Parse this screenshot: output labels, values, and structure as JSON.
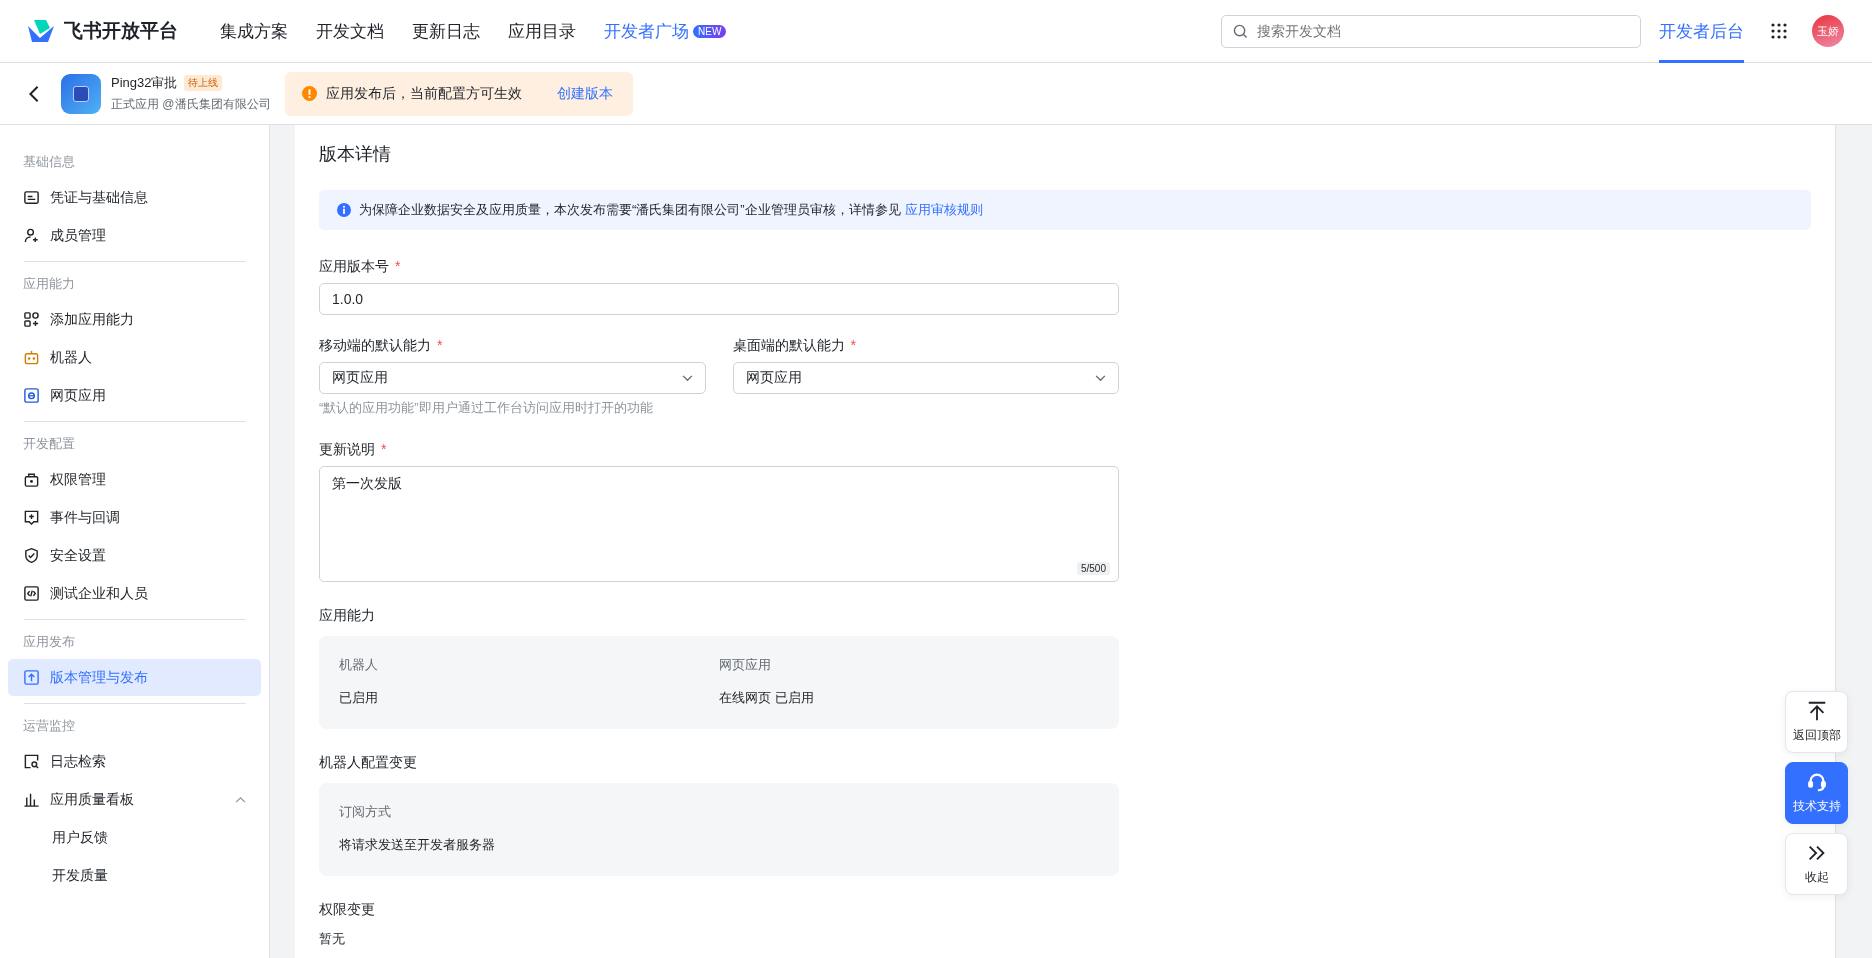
{
  "header": {
    "brand": "飞书开放平台",
    "nav": [
      {
        "label": "集成方案",
        "accent": false
      },
      {
        "label": "开发文档",
        "accent": false
      },
      {
        "label": "更新日志",
        "accent": false
      },
      {
        "label": "应用目录",
        "accent": false
      },
      {
        "label": "开发者广场",
        "accent": true,
        "badge": "NEW"
      }
    ],
    "search": {
      "placeholder": "搜索开发文档"
    },
    "console_link": {
      "label": "开发者后台",
      "selected": true
    },
    "avatar": "玉娇"
  },
  "app_bar": {
    "app_name": "Ping32审批",
    "status_badge": "待上线",
    "subtitle": "正式应用 @潘氏集团有限公司",
    "notice": {
      "text": "应用发布后，当前配置方可生效",
      "link": "创建版本"
    }
  },
  "sidebar": {
    "sections": [
      {
        "title": "基础信息",
        "items": [
          {
            "label": "凭证与基础信息",
            "selected": false
          },
          {
            "label": "成员管理",
            "selected": false
          }
        ]
      },
      {
        "title": "应用能力",
        "items": [
          {
            "label": "添加应用能力",
            "selected": false
          },
          {
            "label": "机器人",
            "selected": false
          },
          {
            "label": "网页应用",
            "selected": false
          }
        ]
      },
      {
        "title": "开发配置",
        "items": [
          {
            "label": "权限管理",
            "selected": false
          },
          {
            "label": "事件与回调",
            "selected": false
          },
          {
            "label": "安全设置",
            "selected": false
          },
          {
            "label": "测试企业和人员",
            "selected": false
          }
        ]
      },
      {
        "title": "应用发布",
        "items": [
          {
            "label": "版本管理与发布",
            "selected": true
          }
        ]
      },
      {
        "title": "运营监控",
        "items": [
          {
            "label": "日志检索",
            "selected": false
          },
          {
            "label": "应用质量看板",
            "selected": false,
            "expanded": true,
            "children": [
              {
                "label": "用户反馈",
                "selected": false
              },
              {
                "label": "开发质量",
                "selected": false
              }
            ]
          }
        ]
      }
    ]
  },
  "main": {
    "title": "版本详情",
    "info": {
      "text": "为保障企业数据安全及应用质量，本次发布需要“潘氏集团有限公司”企业管理员审核，详情参见",
      "link": "应用审核规则"
    },
    "version": {
      "label": "应用版本号",
      "required_mark": "*",
      "value": "1.0.0"
    },
    "selects": [
      {
        "label": "移动端的默认能力",
        "required_mark": "*",
        "value": "网页应用"
      },
      {
        "label": "桌面端的默认能力",
        "required_mark": "*",
        "value": "网页应用"
      }
    ],
    "selects_hint": "“默认的应用功能”即用户通过工作台访问应用时打开的功能",
    "notes": {
      "label": "更新说明",
      "required_mark": "*",
      "value": "第一次发版",
      "counter": "5/500"
    },
    "sections": [
      {
        "title": "应用能力",
        "columns": [
          {
            "label": "机器人",
            "value": "已启用"
          },
          {
            "label": "网页应用",
            "value": "在线网页 已启用"
          }
        ]
      },
      {
        "title": "机器人配置变更",
        "columns": [
          {
            "label": "订阅方式",
            "value": "将请求发送至开发者服务器"
          }
        ]
      }
    ],
    "permissions": {
      "title": "权限变更",
      "value": "暂无"
    }
  },
  "float_buttons": [
    {
      "label": "返回顶部",
      "selected": false
    },
    {
      "label": "技术支持",
      "selected": true
    },
    {
      "label": "收起",
      "selected": false
    }
  ]
}
